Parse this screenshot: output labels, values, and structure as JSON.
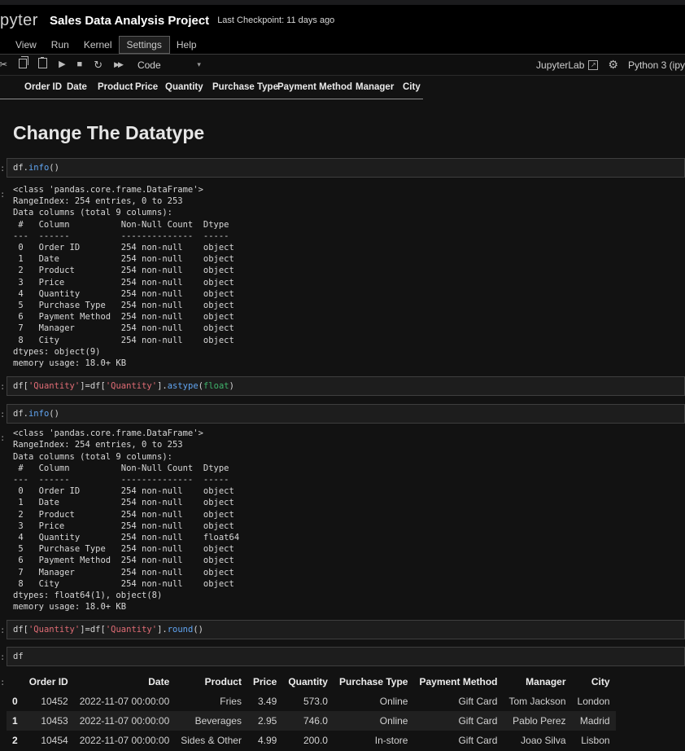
{
  "window": {
    "logo_text": "pyter",
    "title": "Sales Data Analysis Project",
    "checkpoint_label": "Last Checkpoint: 11 days ago"
  },
  "menu": {
    "items": [
      "View",
      "Run",
      "Kernel",
      "Settings",
      "Help"
    ],
    "active_item": "Settings"
  },
  "toolbar": {
    "cell_type": "Code",
    "jupyterlab_label": "JupyterLab",
    "kernel_label": "Python 3 (ipy"
  },
  "prompt_char": ":",
  "scrolled_table_header": [
    "Order ID",
    "Date",
    "Product",
    "Price",
    "Quantity",
    "Purchase Type",
    "Payment Method",
    "Manager",
    "City"
  ],
  "heading": "Change The Datatype",
  "code_cells": {
    "cell1": [
      [
        "var",
        "df"
      ],
      [
        "pun",
        "."
      ],
      [
        "fn",
        "info"
      ],
      [
        "pun",
        "()"
      ]
    ],
    "cell2": [
      [
        "var",
        "df"
      ],
      [
        "pun",
        "["
      ],
      [
        "str",
        "'Quantity'"
      ],
      [
        "pun",
        "]"
      ],
      [
        "op",
        "="
      ],
      [
        "var",
        "df"
      ],
      [
        "pun",
        "["
      ],
      [
        "str",
        "'Quantity'"
      ],
      [
        "pun",
        "]."
      ],
      [
        "fn",
        "astype"
      ],
      [
        "pun",
        "("
      ],
      [
        "blt",
        "float"
      ],
      [
        "pun",
        ")"
      ]
    ],
    "cell3": [
      [
        "var",
        "df"
      ],
      [
        "pun",
        "."
      ],
      [
        "fn",
        "info"
      ],
      [
        "pun",
        "()"
      ]
    ],
    "cell4": [
      [
        "var",
        "df"
      ],
      [
        "pun",
        "["
      ],
      [
        "str",
        "'Quantity'"
      ],
      [
        "pun",
        "]"
      ],
      [
        "op",
        "="
      ],
      [
        "var",
        "df"
      ],
      [
        "pun",
        "["
      ],
      [
        "str",
        "'Quantity'"
      ],
      [
        "pun",
        "]."
      ],
      [
        "fn",
        "round"
      ],
      [
        "pun",
        "()"
      ]
    ],
    "cell5": [
      [
        "var",
        "df"
      ]
    ]
  },
  "outputs": {
    "out1": [
      "<class 'pandas.core.frame.DataFrame'>",
      "RangeIndex: 254 entries, 0 to 253",
      "Data columns (total 9 columns):",
      " #   Column          Non-Null Count  Dtype ",
      "---  ------          --------------  ----- ",
      " 0   Order ID        254 non-null    object",
      " 1   Date            254 non-null    object",
      " 2   Product         254 non-null    object",
      " 3   Price           254 non-null    object",
      " 4   Quantity        254 non-null    object",
      " 5   Purchase Type   254 non-null    object",
      " 6   Payment Method  254 non-null    object",
      " 7   Manager         254 non-null    object",
      " 8   City            254 non-null    object",
      "dtypes: object(9)",
      "memory usage: 18.0+ KB"
    ],
    "out2": [
      "<class 'pandas.core.frame.DataFrame'>",
      "RangeIndex: 254 entries, 0 to 253",
      "Data columns (total 9 columns):",
      " #   Column          Non-Null Count  Dtype  ",
      "---  ------          --------------  -----  ",
      " 0   Order ID        254 non-null    object ",
      " 1   Date            254 non-null    object ",
      " 2   Product         254 non-null    object ",
      " 3   Price           254 non-null    object ",
      " 4   Quantity        254 non-null    float64",
      " 5   Purchase Type   254 non-null    object ",
      " 6   Payment Method  254 non-null    object ",
      " 7   Manager         254 non-null    object ",
      " 8   City            254 non-null    object ",
      "dtypes: float64(1), object(8)",
      "memory usage: 18.0+ KB"
    ]
  },
  "dataframe": {
    "columns": [
      "",
      "Order ID",
      "Date",
      "Product",
      "Price",
      "Quantity",
      "Purchase Type",
      "Payment Method",
      "Manager",
      "City"
    ],
    "rows": [
      [
        "0",
        "10452",
        "2022-11-07 00:00:00",
        "Fries",
        "3.49",
        "573.0",
        "Online",
        "Gift Card",
        "Tom Jackson",
        "London"
      ],
      [
        "1",
        "10453",
        "2022-11-07 00:00:00",
        "Beverages",
        "2.95",
        "746.0",
        "Online",
        "Gift Card",
        "Pablo Perez",
        "Madrid"
      ],
      [
        "2",
        "10454",
        "2022-11-07 00:00:00",
        "Sides & Other",
        "4.99",
        "200.0",
        "In-store",
        "Gift Card",
        "Joao Silva",
        "Lisbon"
      ]
    ]
  },
  "colors": {
    "background": "#121212",
    "cell_background": "#1d1d1d",
    "function_blue": "#61a5f2",
    "string_red": "#e06c75",
    "builtin_green": "#3fb36b",
    "row_stripe": "#202020"
  }
}
